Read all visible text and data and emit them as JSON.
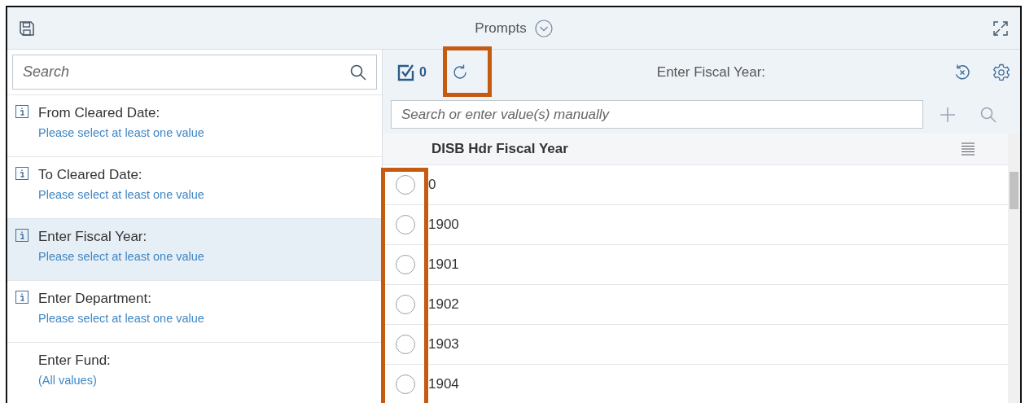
{
  "window": {
    "title": "Prompts"
  },
  "sidebar": {
    "search": {
      "placeholder": "Search"
    },
    "items": [
      {
        "label": "From Cleared Date:",
        "status": "Please select at least one value",
        "info": true,
        "selected": false
      },
      {
        "label": "To Cleared Date:",
        "status": "Please select at least one value",
        "info": true,
        "selected": false
      },
      {
        "label": "Enter Fiscal Year:",
        "status": "Please select at least one value",
        "info": true,
        "selected": true
      },
      {
        "label": "Enter Department:",
        "status": "Please select at least one value",
        "info": true,
        "selected": false
      },
      {
        "label": "Enter Fund:",
        "status": "(All values)",
        "info": false,
        "selected": false
      }
    ]
  },
  "panel": {
    "selected_count": "0",
    "title": "Enter Fiscal Year:",
    "refresh_highlighted": true,
    "search": {
      "placeholder": "Search or enter value(s) manually"
    },
    "table": {
      "column": "DISB Hdr Fiscal Year",
      "radio_column_highlighted": true,
      "rows": [
        {
          "value": "0",
          "selected": false
        },
        {
          "value": "1900",
          "selected": false
        },
        {
          "value": "1901",
          "selected": false
        },
        {
          "value": "1902",
          "selected": false
        },
        {
          "value": "1903",
          "selected": false
        },
        {
          "value": "1904",
          "selected": false
        }
      ]
    }
  }
}
